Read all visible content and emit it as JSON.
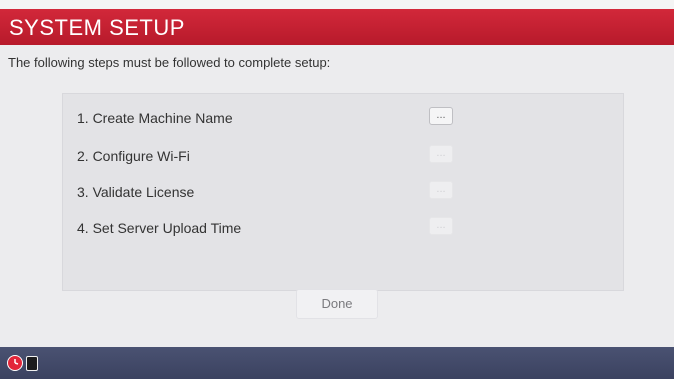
{
  "header": {
    "title": "SYSTEM SETUP"
  },
  "intro_text": "The following steps must be followed to complete setup:",
  "steps": [
    {
      "label": "1. Create Machine Name",
      "button_label": "...",
      "enabled": true
    },
    {
      "label": "2. Configure Wi-Fi",
      "button_label": "...",
      "enabled": false
    },
    {
      "label": "3. Validate License",
      "button_label": "...",
      "enabled": false
    },
    {
      "label": "4. Set Server Upload Time",
      "button_label": "...",
      "enabled": false
    }
  ],
  "done_button": {
    "label": "Done",
    "enabled": false
  },
  "taskbar": {
    "icons": [
      "clock-icon",
      "device-icon"
    ]
  },
  "colors": {
    "header": "#c8202f",
    "taskbar": "#434a68",
    "background": "#ececee"
  }
}
